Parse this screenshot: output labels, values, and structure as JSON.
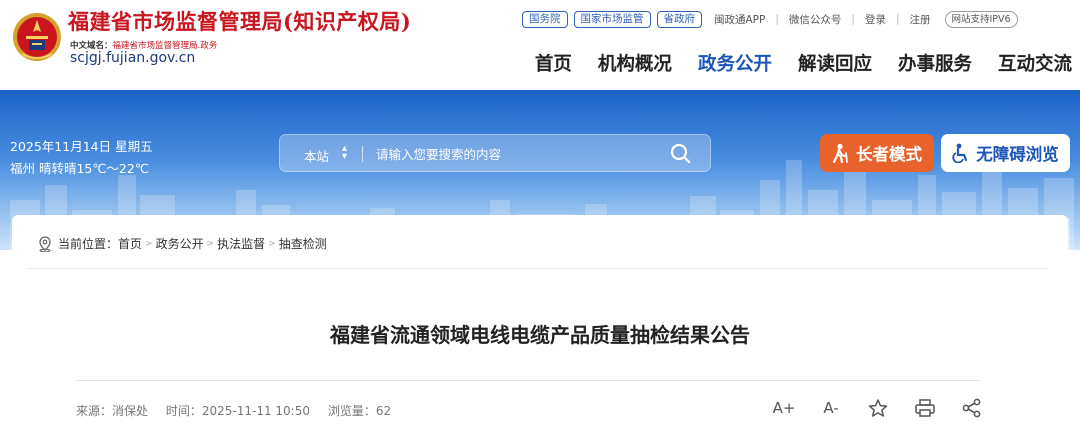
{
  "header": {
    "site_title": "福建省市场监督管理局(知识产权局)",
    "domain_cn_prefix": "中文域名：",
    "domain_cn": "福建省市场监督管理局.政务",
    "domain_en": "scjgj.fujian.gov.cn"
  },
  "top_links": {
    "pills": [
      "国务院",
      "国家市场监管",
      "省政府"
    ],
    "app": "闽政通APP",
    "wechat": "微信公众号",
    "login": "登录",
    "register": "注册",
    "ipv6": "网站支持IPV6"
  },
  "nav": {
    "items": [
      {
        "label": "首页",
        "active": false
      },
      {
        "label": "机构概况",
        "active": false
      },
      {
        "label": "政务公开",
        "active": true
      },
      {
        "label": "解读回应",
        "active": false
      },
      {
        "label": "办事服务",
        "active": false
      },
      {
        "label": "互动交流",
        "active": false
      }
    ]
  },
  "banner": {
    "date": "2025年11月14日 星期五",
    "weather": "福州 晴转晴15℃～22℃",
    "search_scope": "本站",
    "search_placeholder": "请输入您要搜索的内容",
    "elder_mode": "长者模式",
    "accessible": "无障碍浏览"
  },
  "breadcrumb": {
    "label": "当前位置：",
    "items": [
      "首页",
      "政务公开",
      "执法监督",
      "抽查检测"
    ],
    "separator": ">"
  },
  "article": {
    "title": "福建省流通领域电线电缆产品质量抽检结果公告",
    "source": "来源：消保处",
    "time": "时间：2025-11-11 10:50",
    "views": "浏览量：62"
  },
  "tools": {
    "enlarge": "A+",
    "shrink": "A-"
  },
  "colors": {
    "brand_red": "#c9151e",
    "nav_active": "#1c55b8",
    "elder_button": "#e8622c",
    "banner_top": "#1c63c9"
  }
}
